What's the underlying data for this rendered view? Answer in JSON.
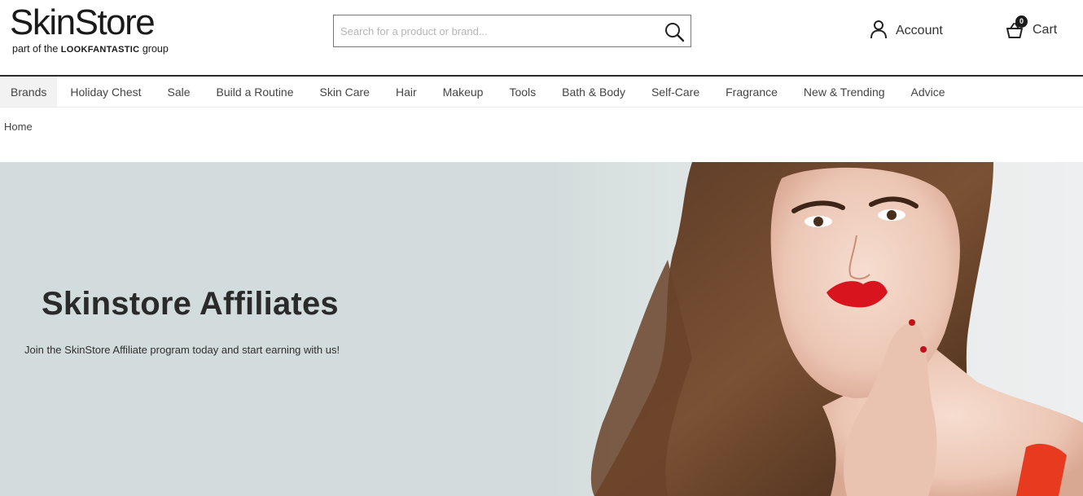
{
  "header": {
    "logo": {
      "name": "SkinStore",
      "tagline_prefix": "part of the",
      "tagline_brand": "LOOKFANTASTIC",
      "tagline_suffix": "group"
    },
    "search": {
      "placeholder": "Search for a product or brand...",
      "value": "",
      "icon": "search-icon"
    },
    "account": {
      "label": "Account",
      "icon": "user-icon"
    },
    "cart": {
      "label": "Cart",
      "count": "0",
      "icon": "basket-icon"
    }
  },
  "nav": {
    "items": [
      {
        "label": "Brands",
        "active": true
      },
      {
        "label": "Holiday Chest"
      },
      {
        "label": "Sale"
      },
      {
        "label": "Build a Routine"
      },
      {
        "label": "Skin Care"
      },
      {
        "label": "Hair"
      },
      {
        "label": "Makeup"
      },
      {
        "label": "Tools"
      },
      {
        "label": "Bath & Body"
      },
      {
        "label": "Self-Care"
      },
      {
        "label": "Fragrance"
      },
      {
        "label": "New & Trending"
      },
      {
        "label": "Advice"
      }
    ]
  },
  "breadcrumb": {
    "items": [
      "Home"
    ]
  },
  "hero": {
    "title": "Skinstore Affiliates",
    "subtitle": "Join the SkinStore Affiliate program today and start earning with us!",
    "background_color": "#d3dcdc",
    "image": "woman-portrait-red-lips"
  },
  "colors": {
    "text": "#222222",
    "nav_rule": "#2b2b2b",
    "hero_bg": "#d3dcdc",
    "lip_red": "#d8141e"
  }
}
